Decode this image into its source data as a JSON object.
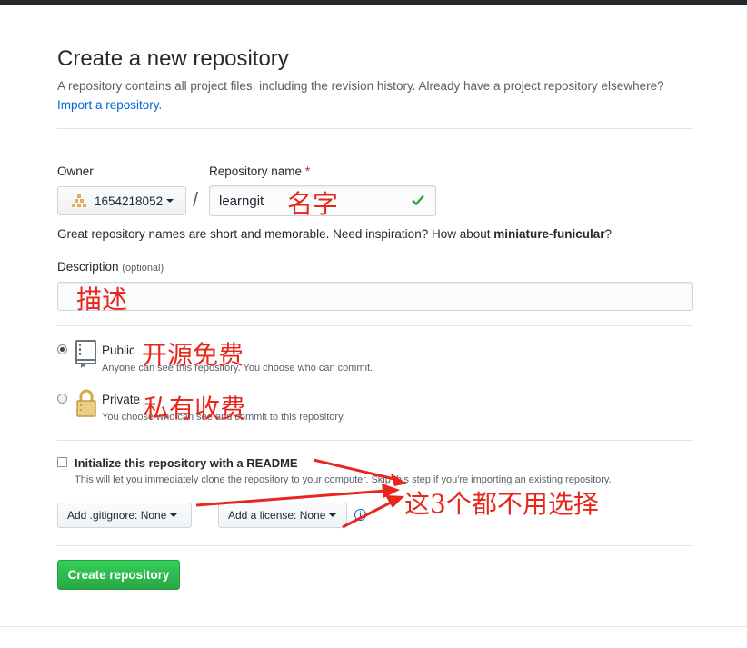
{
  "header": {
    "title": "Create a new repository",
    "subtitle": "A repository contains all project files, including the revision history. Already have a project repository elsewhere?",
    "import_link": "Import a repository."
  },
  "owner": {
    "label": "Owner",
    "value": "1654218052"
  },
  "repo_name": {
    "label": "Repository name",
    "required_mark": "*",
    "value": "learngit",
    "separator": "/"
  },
  "name_hint": {
    "prefix": "Great repository names are short and memorable. Need inspiration? How about ",
    "suggestion": "miniature-funicular",
    "suffix": "?"
  },
  "description": {
    "label": "Description",
    "optional": "(optional)",
    "value": ""
  },
  "visibility": {
    "public": {
      "title": "Public",
      "desc": "Anyone can see this repository. You choose who can commit.",
      "selected": true
    },
    "private": {
      "title": "Private",
      "desc": "You choose who can see and commit to this repository.",
      "selected": false
    }
  },
  "readme": {
    "title": "Initialize this repository with a README",
    "desc": "This will let you immediately clone the repository to your computer. Skip this step if you're importing an existing repository.",
    "checked": false
  },
  "gitignore": {
    "label": "Add .gitignore: None"
  },
  "license": {
    "label": "Add a license: None"
  },
  "info_glyph": "i",
  "create_button": "Create repository",
  "annotations": {
    "name": "名字",
    "description": "描述",
    "public": "开源免费",
    "private": "私有收费",
    "options": "这3个都不用选择"
  },
  "colors": {
    "accent_link": "#0366d6",
    "create_green": "#28a745",
    "annotation_red": "#e8261e"
  },
  "icons": {
    "owner_avatar": "identicon-icon",
    "public": "repo-book-icon",
    "private": "lock-icon",
    "valid": "check-icon",
    "info": "info-icon"
  }
}
